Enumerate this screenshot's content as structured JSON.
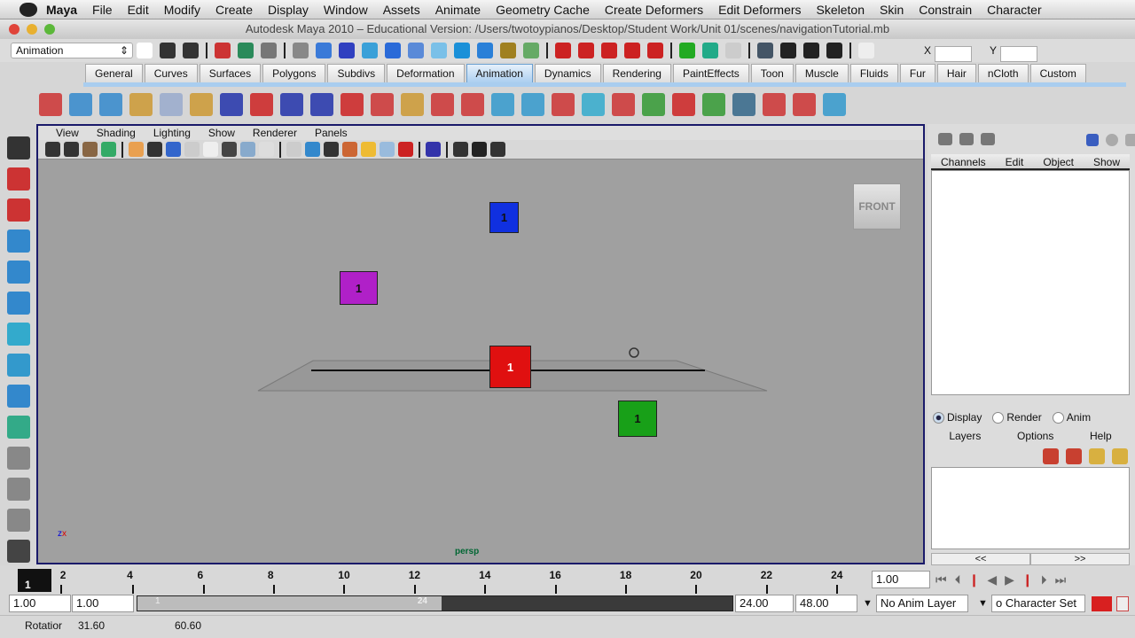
{
  "menubar": {
    "app": "Maya",
    "items": [
      "File",
      "Edit",
      "Modify",
      "Create",
      "Display",
      "Window",
      "Assets",
      "Animate",
      "Geometry Cache",
      "Create Deformers",
      "Edit Deformers",
      "Skeleton",
      "Skin",
      "Constrain",
      "Character"
    ]
  },
  "window": {
    "title": "Autodesk Maya 2010 – Educational Version: /Users/twotoypianos/Desktop/Student Work/Unit 01/scenes/navigationTutorial.mb"
  },
  "status": {
    "menuset": "Animation",
    "x_label": "X",
    "y_label": "Y",
    "x_value": "",
    "y_value": ""
  },
  "shelf": {
    "tabs": [
      "General",
      "Curves",
      "Surfaces",
      "Polygons",
      "Subdivs",
      "Deformation",
      "Animation",
      "Dynamics",
      "Rendering",
      "PaintEffects",
      "Toon",
      "Muscle",
      "Fluids",
      "Fur",
      "Hair",
      "nCloth",
      "Custom"
    ],
    "active": "Animation"
  },
  "viewport": {
    "menus": [
      "View",
      "Shading",
      "Lighting",
      "Show",
      "Renderer",
      "Panels"
    ],
    "camera": "persp",
    "viewcube": "FRONT",
    "objects": [
      {
        "label": "1",
        "color": "#1030e0"
      },
      {
        "label": "1",
        "color": "#b020c8"
      },
      {
        "label": "1",
        "color": "#e01010"
      },
      {
        "label": "1",
        "color": "#18a018"
      }
    ],
    "axis": {
      "x": "x",
      "z": "z"
    }
  },
  "channelbox": {
    "menus": [
      "Channels",
      "Edit",
      "Object",
      "Show"
    ]
  },
  "layers": {
    "modes": [
      "Display",
      "Render",
      "Anim"
    ],
    "selected": "Display",
    "menus": [
      "Layers",
      "Options",
      "Help"
    ],
    "prev": "<<",
    "next": ">>"
  },
  "timeline": {
    "ticks": [
      "2",
      "4",
      "6",
      "8",
      "10",
      "12",
      "14",
      "16",
      "18",
      "20",
      "22",
      "24"
    ],
    "current_frame": "1",
    "current_time": "1.00",
    "start": "1.00",
    "playback_start": "1.00",
    "range_start_label": "1",
    "range_end_label": "24",
    "playback_end": "24.00",
    "end": "48.00",
    "anim_layer": "No Anim Layer",
    "character_set": "o Character Set"
  },
  "helpline": {
    "label": "Rotatior",
    "value1": "31.60",
    "value2": "60.60"
  }
}
